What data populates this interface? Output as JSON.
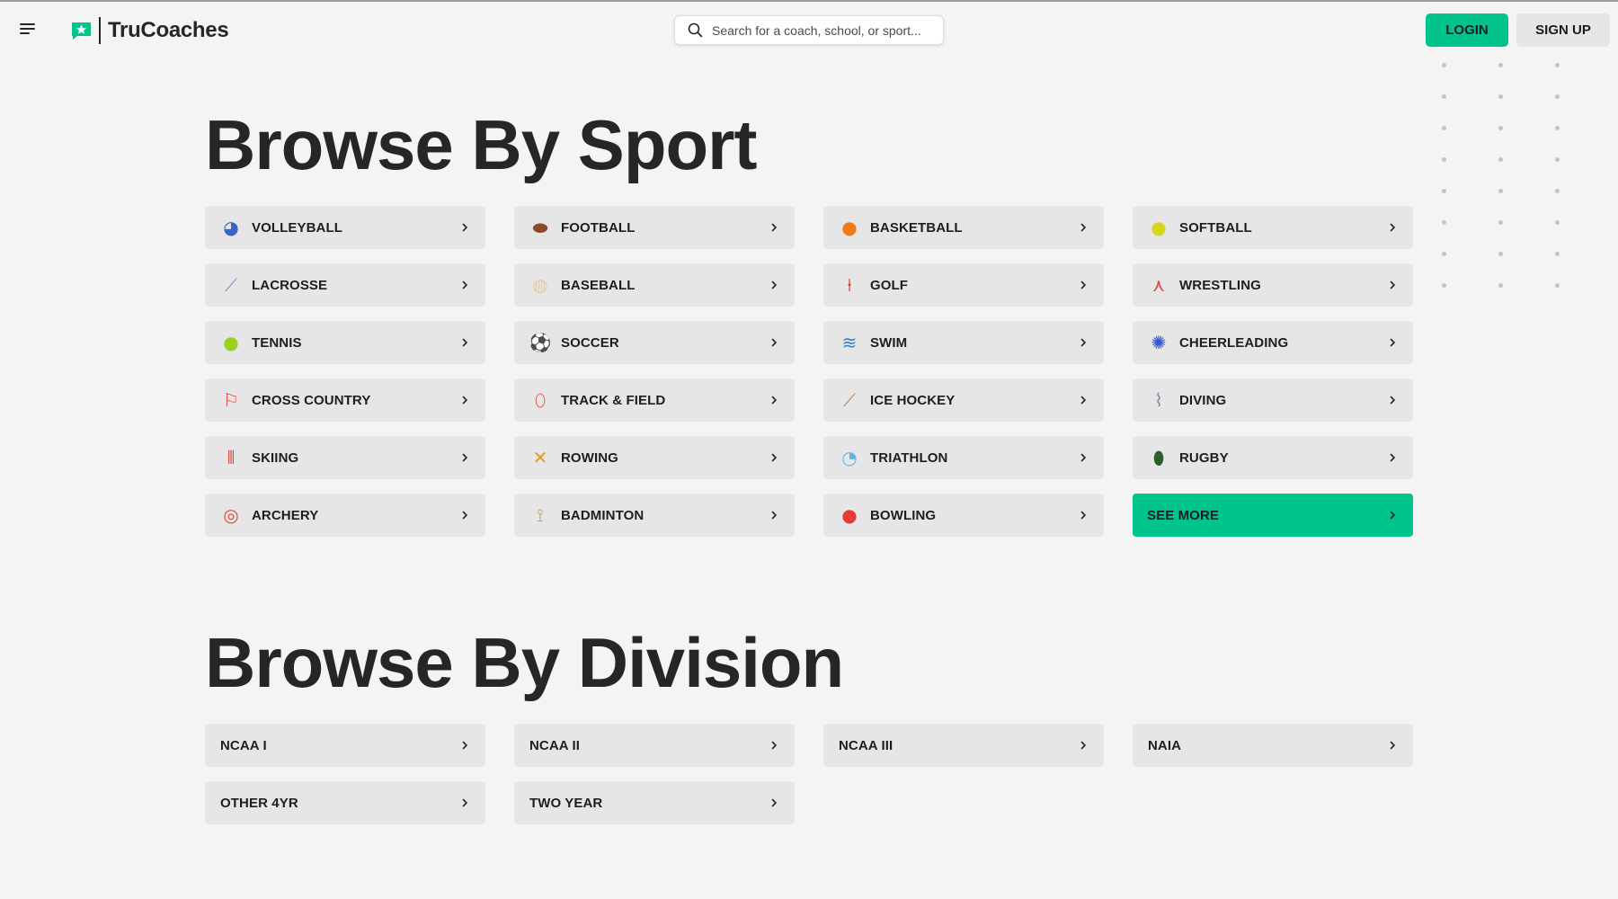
{
  "header": {
    "brand": "TruCoaches",
    "search_placeholder": "Search for a coach, school, or sport...",
    "login_label": "LOGIN",
    "signup_label": "SIGN UP"
  },
  "colors": {
    "accent": "#00c48c",
    "tile": "#e6e6e6",
    "background": "#f4f4f4",
    "text": "#262626"
  },
  "sport_section": {
    "heading": "Browse By Sport",
    "items": [
      {
        "label": "VOLLEYBALL",
        "icon": "volleyball-icon",
        "glyph": "◕",
        "color": "#3a63c9"
      },
      {
        "label": "FOOTBALL",
        "icon": "football-icon",
        "glyph": "⬬",
        "color": "#8a4b2d"
      },
      {
        "label": "BASKETBALL",
        "icon": "basketball-icon",
        "glyph": "●",
        "color": "#f07a1a"
      },
      {
        "label": "SOFTBALL",
        "icon": "softball-icon",
        "glyph": "●",
        "color": "#d7d51c"
      },
      {
        "label": "LACROSSE",
        "icon": "lacrosse-icon",
        "glyph": "⟋",
        "color": "#6b8fc9"
      },
      {
        "label": "BASEBALL",
        "icon": "baseball-icon",
        "glyph": "◍",
        "color": "#e8c9a0"
      },
      {
        "label": "GOLF",
        "icon": "golf-icon",
        "glyph": "⍿",
        "color": "#d33a2c"
      },
      {
        "label": "WRESTLING",
        "icon": "wrestling-icon",
        "glyph": "⋏",
        "color": "#d9473e"
      },
      {
        "label": "TENNIS",
        "icon": "tennis-icon",
        "glyph": "●",
        "color": "#9ccf1f"
      },
      {
        "label": "SOCCER",
        "icon": "soccer-icon",
        "glyph": "⚽",
        "color": "#222222"
      },
      {
        "label": "SWIM",
        "icon": "swim-icon",
        "glyph": "≋",
        "color": "#2f7fd8"
      },
      {
        "label": "CHEERLEADING",
        "icon": "cheerleading-icon",
        "glyph": "✺",
        "color": "#3b56c4"
      },
      {
        "label": "CROSS COUNTRY",
        "icon": "cross-country-icon",
        "glyph": "⚐",
        "color": "#e0443a"
      },
      {
        "label": "TRACK & FIELD",
        "icon": "track-field-icon",
        "glyph": "⬯",
        "color": "#e25b45"
      },
      {
        "label": "ICE HOCKEY",
        "icon": "ice-hockey-icon",
        "glyph": "⟋",
        "color": "#c87a3a"
      },
      {
        "label": "DIVING",
        "icon": "diving-icon",
        "glyph": "⌇",
        "color": "#7d8fa6"
      },
      {
        "label": "SKIING",
        "icon": "skiing-icon",
        "glyph": "⦀",
        "color": "#d94b3b"
      },
      {
        "label": "ROWING",
        "icon": "rowing-icon",
        "glyph": "✕",
        "color": "#e39a2a"
      },
      {
        "label": "TRIATHLON",
        "icon": "triathlon-icon",
        "glyph": "◔",
        "color": "#5fb3e0"
      },
      {
        "label": "RUGBY",
        "icon": "rugby-icon",
        "glyph": "⬮",
        "color": "#2e5e2b"
      },
      {
        "label": "ARCHERY",
        "icon": "archery-icon",
        "glyph": "◎",
        "color": "#e0443a"
      },
      {
        "label": "BADMINTON",
        "icon": "badminton-icon",
        "glyph": "⟟",
        "color": "#c7a06a"
      },
      {
        "label": "BOWLING",
        "icon": "bowling-icon",
        "glyph": "●",
        "color": "#e6393a"
      }
    ],
    "see_more_label": "SEE MORE"
  },
  "division_section": {
    "heading": "Browse By Division",
    "items": [
      {
        "label": "NCAA I"
      },
      {
        "label": "NCAA II"
      },
      {
        "label": "NCAA III"
      },
      {
        "label": "NAIA"
      },
      {
        "label": "OTHER 4YR"
      },
      {
        "label": "TWO YEAR"
      }
    ]
  }
}
